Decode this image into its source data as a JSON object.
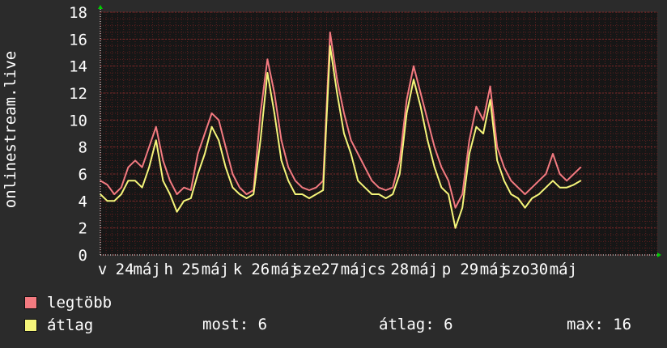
{
  "colors": {
    "background": "#2b2b2b",
    "plot_background": "#161616",
    "grid": "#5a1f1f",
    "axis": "#ffffff",
    "axis_arrow": "#00cc00",
    "series_max": "#f37a80",
    "series_avg": "#f5f57a"
  },
  "chart_data": {
    "type": "line",
    "title": "",
    "ylabel": "onlinestream.live",
    "xlabel": "",
    "ylim": [
      0,
      18
    ],
    "yticks": [
      0,
      2,
      4,
      6,
      8,
      10,
      12,
      14,
      16,
      18
    ],
    "grid": true,
    "legend_position": "bottom-left",
    "x_tick_labels": [
      "v",
      "24",
      "máj",
      "h",
      "25",
      "máj",
      "k",
      "26",
      "máj",
      "sze",
      "27",
      "máj",
      "cs",
      "28",
      "máj",
      "p",
      "29",
      "máj",
      "szo",
      "30",
      "máj"
    ],
    "x_domain": [
      0,
      8
    ],
    "x_tick_positions": [
      0.03,
      0.35,
      0.67,
      0.98,
      1.3,
      1.65,
      1.97,
      2.3,
      2.65,
      2.97,
      3.3,
      3.65,
      3.97,
      4.3,
      4.65,
      4.97,
      5.3,
      5.65,
      5.97,
      6.3,
      6.65
    ],
    "x": [
      0,
      0.1,
      0.2,
      0.3,
      0.4,
      0.5,
      0.6,
      0.7,
      0.8,
      0.9,
      1.0,
      1.1,
      1.2,
      1.3,
      1.4,
      1.5,
      1.6,
      1.7,
      1.8,
      1.9,
      2.0,
      2.1,
      2.2,
      2.3,
      2.4,
      2.5,
      2.6,
      2.7,
      2.8,
      2.9,
      3.0,
      3.1,
      3.2,
      3.3,
      3.4,
      3.5,
      3.6,
      3.7,
      3.8,
      3.9,
      4.0,
      4.1,
      4.2,
      4.3,
      4.4,
      4.5,
      4.6,
      4.7,
      4.8,
      4.9,
      5.0,
      5.1,
      5.2,
      5.3,
      5.4,
      5.5,
      5.6,
      5.7,
      5.8,
      5.9,
      6.0,
      6.1,
      6.2,
      6.3,
      6.4,
      6.5,
      6.6,
      6.7,
      6.8,
      6.9
    ],
    "series": [
      {
        "name": "legtöbb",
        "values": [
          5.5,
          5.2,
          4.5,
          5.0,
          6.5,
          7.0,
          6.5,
          8.0,
          9.5,
          7.0,
          5.5,
          4.5,
          5.0,
          4.8,
          7.5,
          9.0,
          10.5,
          10.0,
          8.0,
          6.0,
          5.0,
          4.5,
          4.8,
          10.5,
          14.5,
          12.0,
          8.5,
          6.5,
          5.5,
          5.0,
          4.8,
          5.0,
          5.5,
          16.5,
          13.0,
          10.5,
          8.5,
          7.5,
          6.5,
          5.5,
          5.0,
          4.8,
          5.0,
          7.0,
          11.5,
          14.0,
          12.0,
          10.0,
          8.0,
          6.5,
          5.5,
          3.5,
          4.5,
          8.5,
          11.0,
          10.0,
          12.5,
          8.0,
          6.5,
          5.5,
          5.0,
          4.5,
          5.0,
          5.5,
          6.0,
          7.5,
          6.0,
          5.5,
          6.0,
          6.5
        ]
      },
      {
        "name": "átlag",
        "values": [
          4.5,
          4.0,
          4.0,
          4.5,
          5.5,
          5.5,
          5.0,
          6.5,
          8.5,
          5.5,
          4.5,
          3.2,
          4.0,
          4.2,
          6.0,
          7.5,
          9.5,
          8.5,
          6.5,
          5.0,
          4.5,
          4.2,
          4.5,
          8.5,
          13.5,
          10.5,
          7.0,
          5.5,
          4.5,
          4.5,
          4.2,
          4.5,
          4.8,
          15.5,
          12.0,
          9.0,
          7.5,
          5.5,
          5.0,
          4.5,
          4.5,
          4.2,
          4.5,
          6.0,
          10.5,
          13.0,
          11.0,
          8.5,
          6.5,
          5.0,
          4.5,
          2.0,
          3.5,
          7.5,
          9.5,
          9.0,
          11.5,
          7.0,
          5.5,
          4.5,
          4.2,
          3.5,
          4.2,
          4.5,
          5.0,
          5.5,
          5.0,
          5.0,
          5.2,
          5.5
        ]
      }
    ]
  },
  "legend": {
    "max_label": "legtöbb",
    "avg_label": "átlag"
  },
  "stats": {
    "now": "most: 6",
    "average": "átlag: 6",
    "max": "max: 16"
  }
}
